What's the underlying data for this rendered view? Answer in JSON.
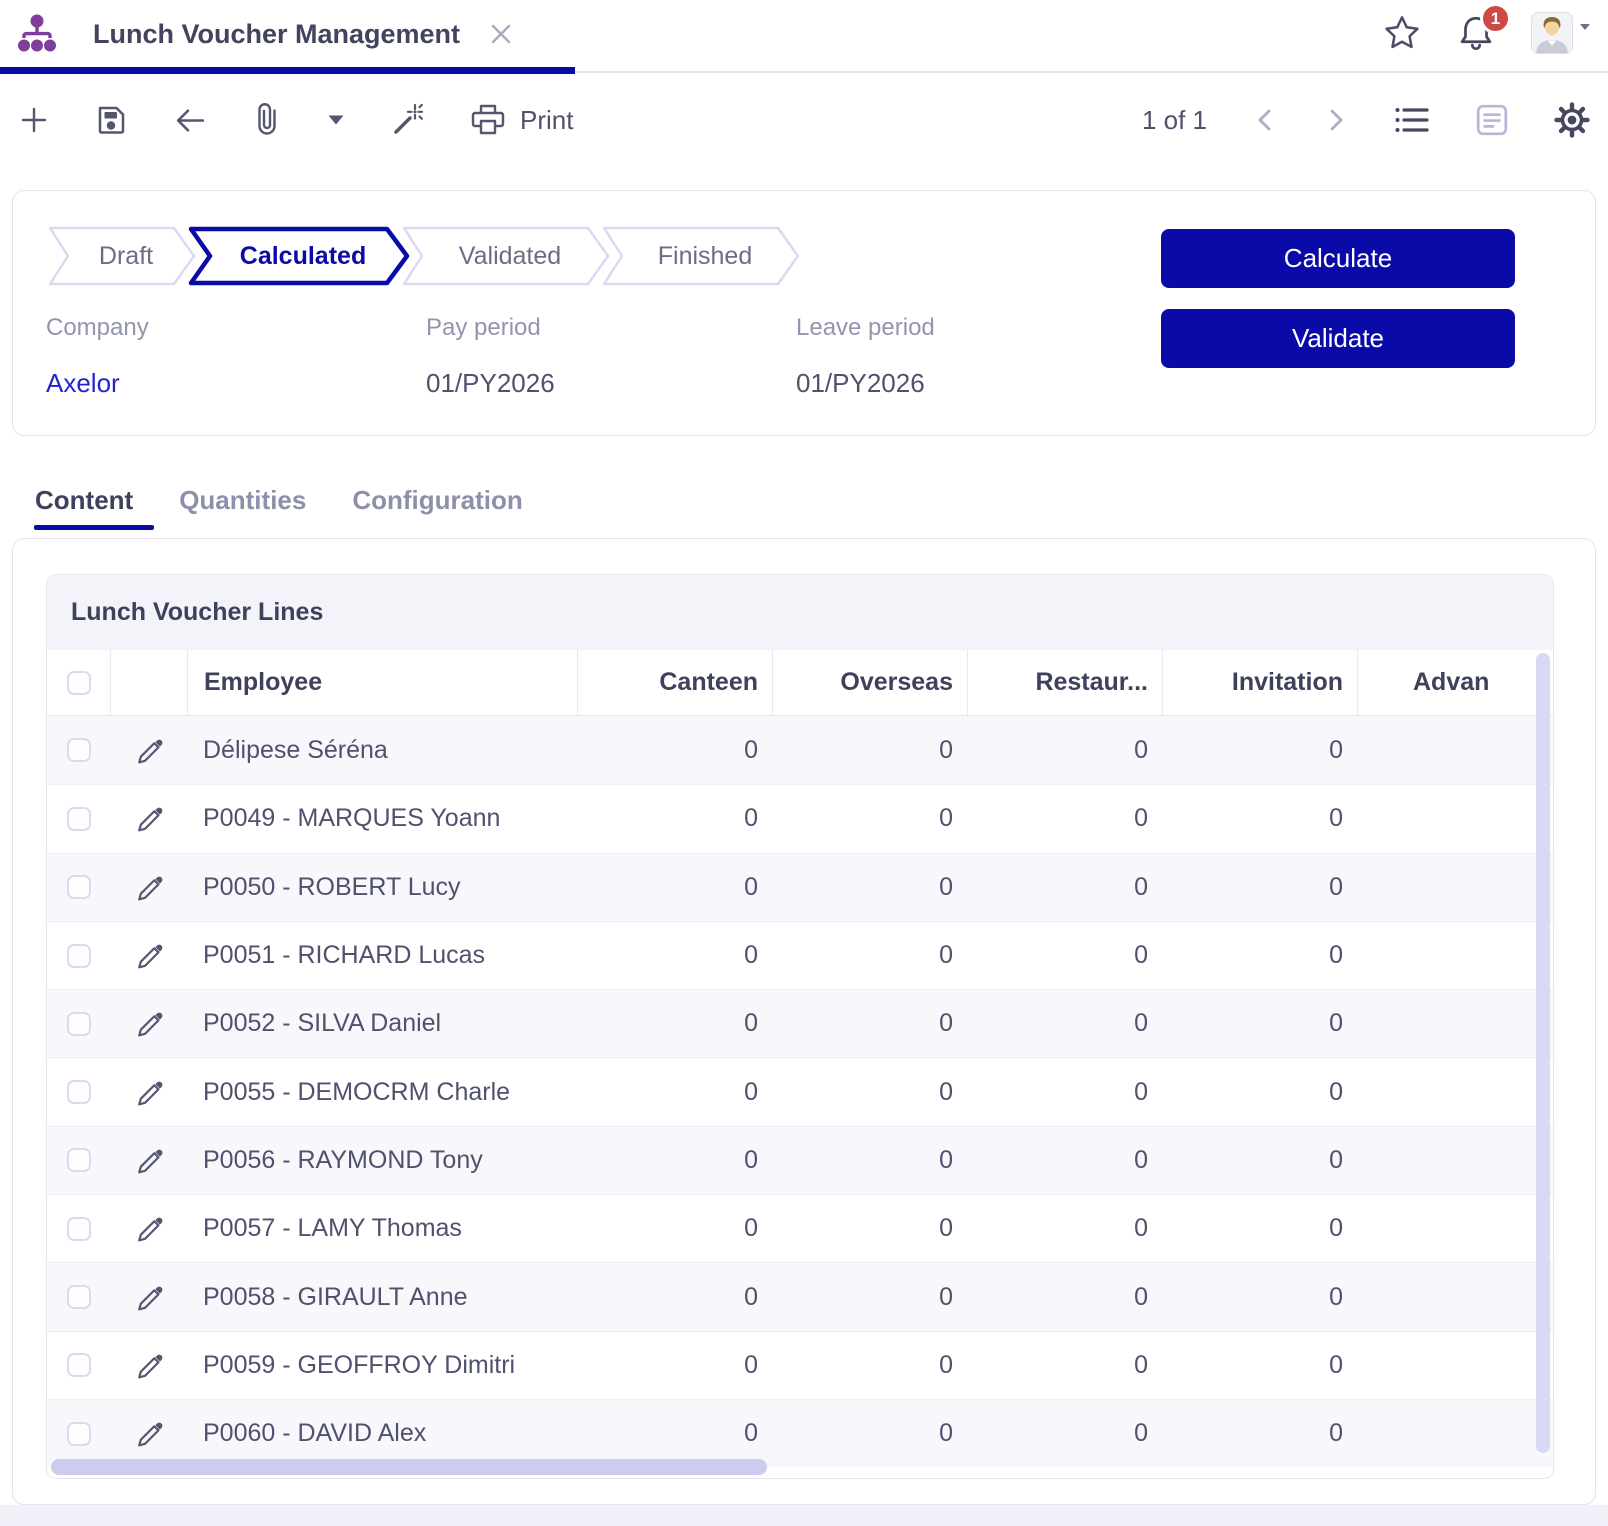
{
  "colors": {
    "accent": "#0a0aa8",
    "link": "#2424cd",
    "badge": "#cd4a46",
    "module": "#7d3f9b"
  },
  "topbar": {
    "tab_title": "Lunch Voucher Management",
    "notification_count": "1"
  },
  "toolbar": {
    "print_label": "Print",
    "pager": "1 of 1"
  },
  "statusbar": {
    "steps": [
      {
        "label": "Draft"
      },
      {
        "label": "Calculated",
        "active": true
      },
      {
        "label": "Validated"
      },
      {
        "label": "Finished"
      }
    ],
    "fields": [
      {
        "label": "Company",
        "value": "Axelor"
      },
      {
        "label": "Pay period",
        "value": "01/PY2026"
      },
      {
        "label": "Leave period",
        "value": "01/PY2026"
      }
    ],
    "actions": [
      {
        "label": "Calculate"
      },
      {
        "label": "Validate"
      }
    ]
  },
  "tabs": [
    {
      "label": "Content",
      "active": true
    },
    {
      "label": "Quantities"
    },
    {
      "label": "Configuration"
    }
  ],
  "table": {
    "title": "Lunch Voucher Lines",
    "columns": [
      "Employee",
      "Canteen",
      "Overseas",
      "Restaur...",
      "Invitation",
      "Advan"
    ],
    "rows": [
      {
        "employee": "Délipese Séréna",
        "canteen": "0",
        "overseas": "0",
        "restaurant": "0",
        "invitation": "0"
      },
      {
        "employee": "P0049 - MARQUES Yoann",
        "canteen": "0",
        "overseas": "0",
        "restaurant": "0",
        "invitation": "0"
      },
      {
        "employee": "P0050 - ROBERT Lucy",
        "canteen": "0",
        "overseas": "0",
        "restaurant": "0",
        "invitation": "0"
      },
      {
        "employee": "P0051 - RICHARD Lucas",
        "canteen": "0",
        "overseas": "0",
        "restaurant": "0",
        "invitation": "0"
      },
      {
        "employee": "P0052 - SILVA Daniel",
        "canteen": "0",
        "overseas": "0",
        "restaurant": "0",
        "invitation": "0"
      },
      {
        "employee": "P0055 - DEMOCRM Charle",
        "canteen": "0",
        "overseas": "0",
        "restaurant": "0",
        "invitation": "0"
      },
      {
        "employee": "P0056 - RAYMOND Tony",
        "canteen": "0",
        "overseas": "0",
        "restaurant": "0",
        "invitation": "0"
      },
      {
        "employee": "P0057 - LAMY Thomas",
        "canteen": "0",
        "overseas": "0",
        "restaurant": "0",
        "invitation": "0"
      },
      {
        "employee": "P0058 - GIRAULT Anne",
        "canteen": "0",
        "overseas": "0",
        "restaurant": "0",
        "invitation": "0"
      },
      {
        "employee": "P0059 - GEOFFROY Dimitri",
        "canteen": "0",
        "overseas": "0",
        "restaurant": "0",
        "invitation": "0"
      },
      {
        "employee": "P0060 - DAVID Alex",
        "canteen": "0",
        "overseas": "0",
        "restaurant": "0",
        "invitation": "0"
      }
    ]
  }
}
